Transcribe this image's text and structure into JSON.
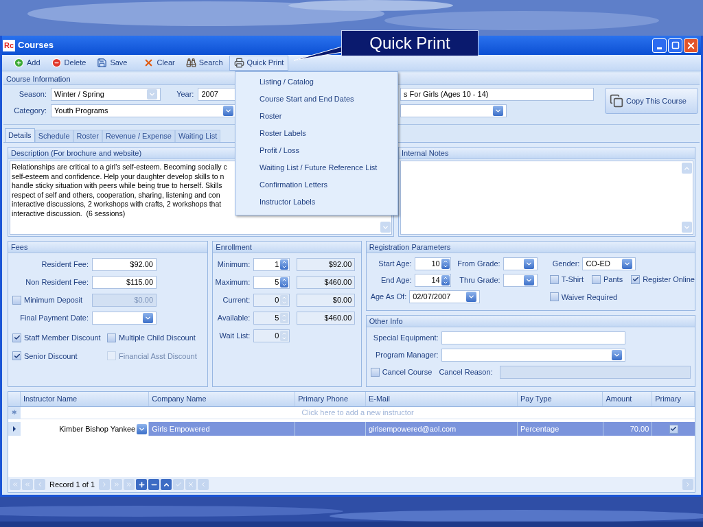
{
  "window": {
    "title": "Courses",
    "logo": "Rc"
  },
  "callout": {
    "text": "Quick Print"
  },
  "toolbar": [
    {
      "label": "Add",
      "kind": "add",
      "selected": false
    },
    {
      "label": "Delete",
      "kind": "delete",
      "selected": false
    },
    {
      "label": "Save",
      "kind": "save",
      "selected": false
    },
    {
      "label": "Clear",
      "kind": "clear",
      "selected": false
    },
    {
      "label": "Search",
      "kind": "search",
      "selected": false
    },
    {
      "label": "Quick Print",
      "kind": "print",
      "selected": true
    }
  ],
  "quick_print_menu": [
    "Listing / Catalog",
    "Course Start and End Dates",
    "Roster",
    "Roster Labels",
    "Profit / Loss",
    "Waiting List / Future Reference List",
    "Confirmation Letters",
    "Instructor Labels"
  ],
  "course_info": {
    "title": "Course Information",
    "season": {
      "label": "Season:",
      "value": "Winter / Spring"
    },
    "year": {
      "label": "Year:",
      "value": "2007"
    },
    "category": {
      "label": "Category:",
      "value": "Youth Programs"
    },
    "course_name": "s For Girls (Ages 10 - 14)",
    "copy_button": "Copy This Course"
  },
  "tabs": [
    {
      "label": "Details",
      "selected": true
    },
    {
      "label": "Schedule",
      "selected": false
    },
    {
      "label": "Roster",
      "selected": false
    },
    {
      "label": "Revenue / Expense",
      "selected": false
    },
    {
      "label": "Waiting List",
      "selected": false
    }
  ],
  "description": {
    "title": "Description (For brochure and website)",
    "lines": [
      "Relationships are critical to a girl's self-esteem. Becoming socially c",
      "self-esteem and confidence. Help your daughter develop skills to n",
      "handle sticky situation with peers while being true to herself. Skills",
      "respect of self and others, cooperation, sharing, listening and con",
      "interactive discussions, 2 workshops with crafts, 2 workshops that",
      "interactive discussion.  (6 sessions)"
    ]
  },
  "internal_notes": {
    "title": "Internal Notes"
  },
  "fees": {
    "title": "Fees",
    "rows": [
      {
        "kind": "text",
        "label": "Resident Fee:",
        "value": "$92.00"
      },
      {
        "kind": "text",
        "label": "Non Resident Fee:",
        "value": "$115.00"
      },
      {
        "kind": "check",
        "label": "Minimum Deposit",
        "value": "$0.00",
        "checked": false
      },
      {
        "kind": "date",
        "label": "Final Payment Date:"
      }
    ],
    "discounts": [
      {
        "label": "Staff Member Discount",
        "checked": true,
        "disabled": false
      },
      {
        "label": "Multiple Child Discount",
        "checked": false,
        "disabled": false
      },
      {
        "label": "Senior Discount",
        "checked": true,
        "disabled": false
      },
      {
        "label": "Financial Asst Discount",
        "checked": false,
        "disabled": true
      }
    ]
  },
  "enrollment": {
    "title": "Enrollment",
    "rows": [
      {
        "label": "Minimum:",
        "count": "1",
        "amount": "$92.00",
        "disabled": false
      },
      {
        "label": "Maximum:",
        "count": "5",
        "amount": "$460.00",
        "disabled": false
      },
      {
        "label": "Current:",
        "count": "0",
        "amount": "$0.00",
        "disabled": true
      },
      {
        "label": "Available:",
        "count": "5",
        "amount": "$460.00",
        "disabled": true
      },
      {
        "label": "Wait List:",
        "count": "0",
        "disabled": true
      }
    ]
  },
  "registration": {
    "title": "Registration Parameters",
    "start_age": {
      "label": "Start Age:",
      "value": "10"
    },
    "end_age": {
      "label": "End Age:",
      "value": "14"
    },
    "from_grade": {
      "label": "From Grade:"
    },
    "thru_grade": {
      "label": "Thru Grade:"
    },
    "age_as_of": {
      "label": "Age As Of:",
      "value": "02/07/2007"
    },
    "gender": {
      "label": "Gender:",
      "value": "CO-ED"
    },
    "options": [
      {
        "label": "T-Shirt",
        "checked": false
      },
      {
        "label": "Pants",
        "checked": false
      },
      {
        "label": "Register Online",
        "checked": true
      },
      {
        "label": "Waiver Required",
        "checked": false
      }
    ]
  },
  "other_info": {
    "title": "Other Info",
    "special_equipment": {
      "label": "Special Equipment:"
    },
    "program_manager": {
      "label": "Program Manager:"
    },
    "cancel_course": {
      "label": "Cancel Course",
      "checked": false
    },
    "cancel_reason": {
      "label": "Cancel Reason:"
    }
  },
  "instructors": {
    "columns": [
      "Instructor Name",
      "Company Name",
      "Primary Phone",
      "E-Mail",
      "Pay Type",
      "Amount",
      "Primary"
    ],
    "new_row_hint": "Click here to add a new instructor",
    "new_row_marker": "✱",
    "rows": [
      {
        "selected": true,
        "instructor": "Kimber Bishop Yankee",
        "company": "Girls Empowered",
        "email": "girlsempowered@aol.com",
        "pay_type": "Percentage",
        "amount": "70.00",
        "primary": true
      }
    ],
    "navigator": "Record 1 of 1"
  }
}
